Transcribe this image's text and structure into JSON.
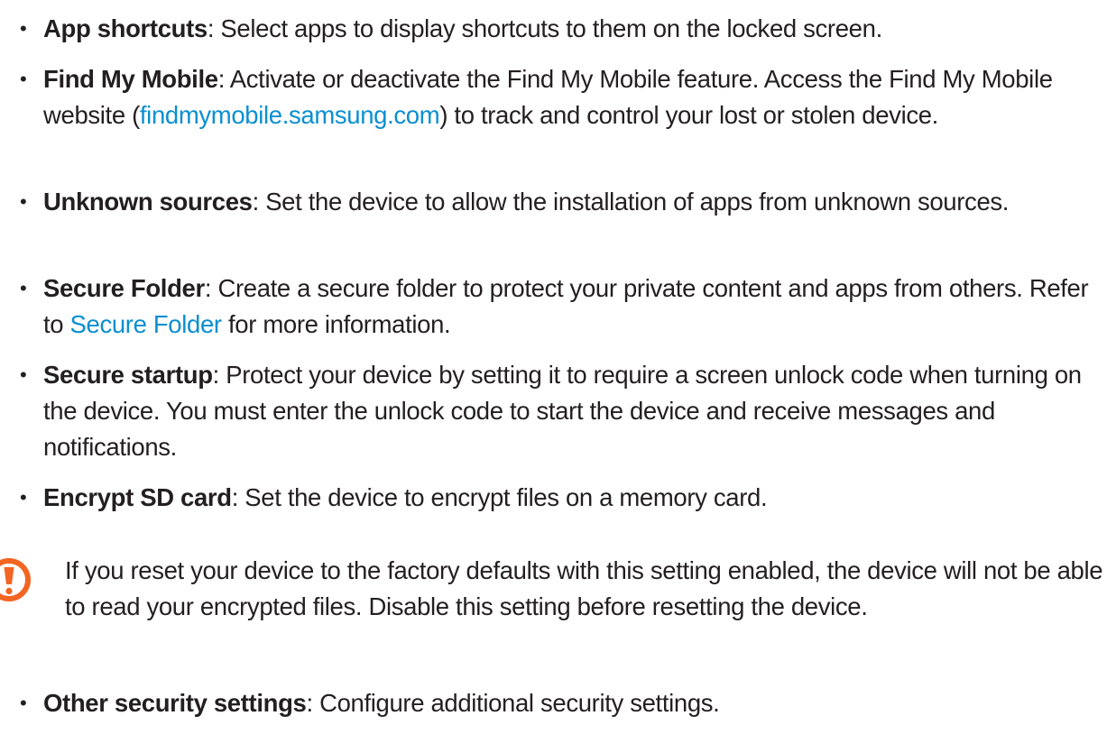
{
  "items": [
    {
      "term": "App shortcuts",
      "desc": ": Select apps to display shortcuts to them on the locked screen."
    },
    {
      "term": "Find My Mobile",
      "desc_before": ": Activate or deactivate the Find My Mobile feature. Access the Find My Mobile website (",
      "link": "findmymobile.samsung.com",
      "desc_after": ") to track and control your lost or stolen device."
    },
    {
      "term": "Unknown sources",
      "desc": ": Set the device to allow the installation of apps from unknown sources."
    },
    {
      "term": "Secure Folder",
      "desc_before": ": Create a secure folder to protect your private content and apps from others. Refer to ",
      "link": "Secure Folder",
      "desc_after": " for more information."
    },
    {
      "term": "Secure startup",
      "desc": ": Protect your device by setting it to require a screen unlock code when turning on the device. You must enter the unlock code to start the device and receive messages and notifications."
    },
    {
      "term": "Encrypt SD card",
      "desc": ": Set the device to encrypt files on a memory card."
    },
    {
      "term": "Other security settings",
      "desc": ": Configure additional security settings."
    }
  ],
  "bullet": "•",
  "caution": {
    "icon": "caution-icon",
    "color": "#f26522",
    "text": "If you reset your device to the factory defaults with this setting enabled, the device will not be able to read your encrypted files. Disable this setting before resetting the device."
  },
  "link_color": "#0a8fd0"
}
